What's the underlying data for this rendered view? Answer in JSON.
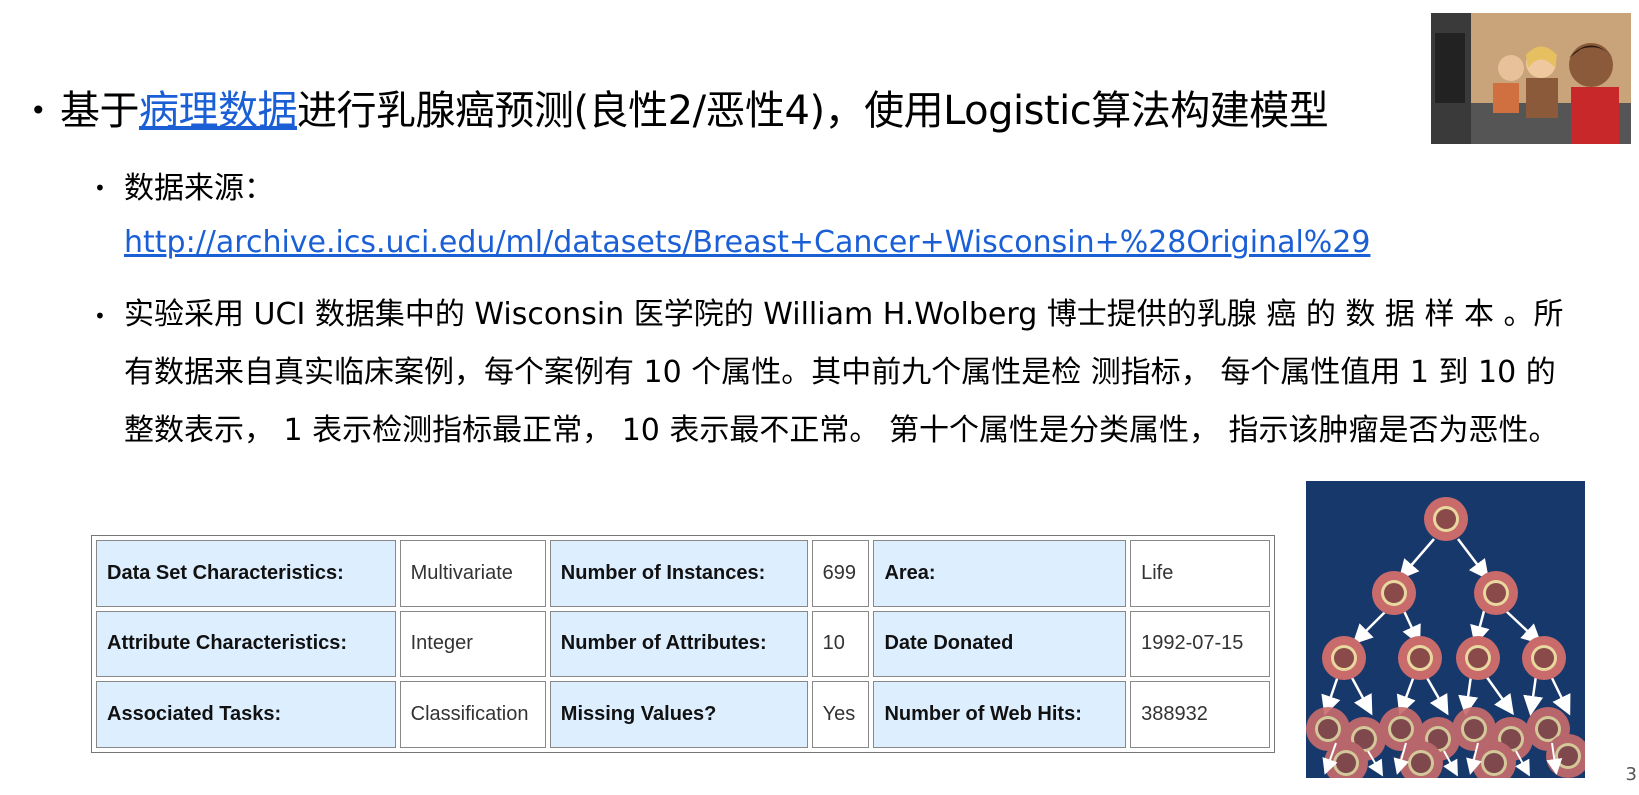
{
  "title": {
    "prefix": "基于",
    "link_text": "病理数据",
    "suffix": "进行乳腺癌预测(良性2/恶性4)，使用Logistic算法构建模型"
  },
  "source": {
    "label": "数据来源：",
    "url": "http://archive.ics.uci.edu/ml/datasets/Breast+Cancer+Wisconsin+%28Original%29"
  },
  "description": "实验采用 UCI 数据集中的 Wisconsin 医学院的 William H.Wolberg 博士提供的乳腺 癌 的 数 据 样 本 。所有数据来自真实临床案例，每个案例有 10 个属性。其中前九个属性是检 测指标， 每个属性值用 1 到 10 的整数表示， 1 表示检测指标最正常， 10 表示最不正常。 第十个属性是分类属性， 指示该肿瘤是否为恶性。",
  "table": {
    "rows": [
      [
        {
          "label": "Data Set Characteristics:",
          "value": "Multivariate"
        },
        {
          "label": "Number of Instances:",
          "value": "699"
        },
        {
          "label": "Area:",
          "value": "Life"
        }
      ],
      [
        {
          "label": "Attribute Characteristics:",
          "value": "Integer"
        },
        {
          "label": "Number of Attributes:",
          "value": "10"
        },
        {
          "label": "Date Donated",
          "value": "1992-07-15"
        }
      ],
      [
        {
          "label": "Associated Tasks:",
          "value": "Classification"
        },
        {
          "label": "Missing Values?",
          "value": "Yes"
        },
        {
          "label": "Number of Web Hits:",
          "value": "388932"
        }
      ]
    ]
  },
  "page_number": "3",
  "colors": {
    "link": "#1a5fd6",
    "table_header_bg": "#ddeeff",
    "diagram_bg": "#17386b",
    "cell_fill": "#c96b6b"
  }
}
